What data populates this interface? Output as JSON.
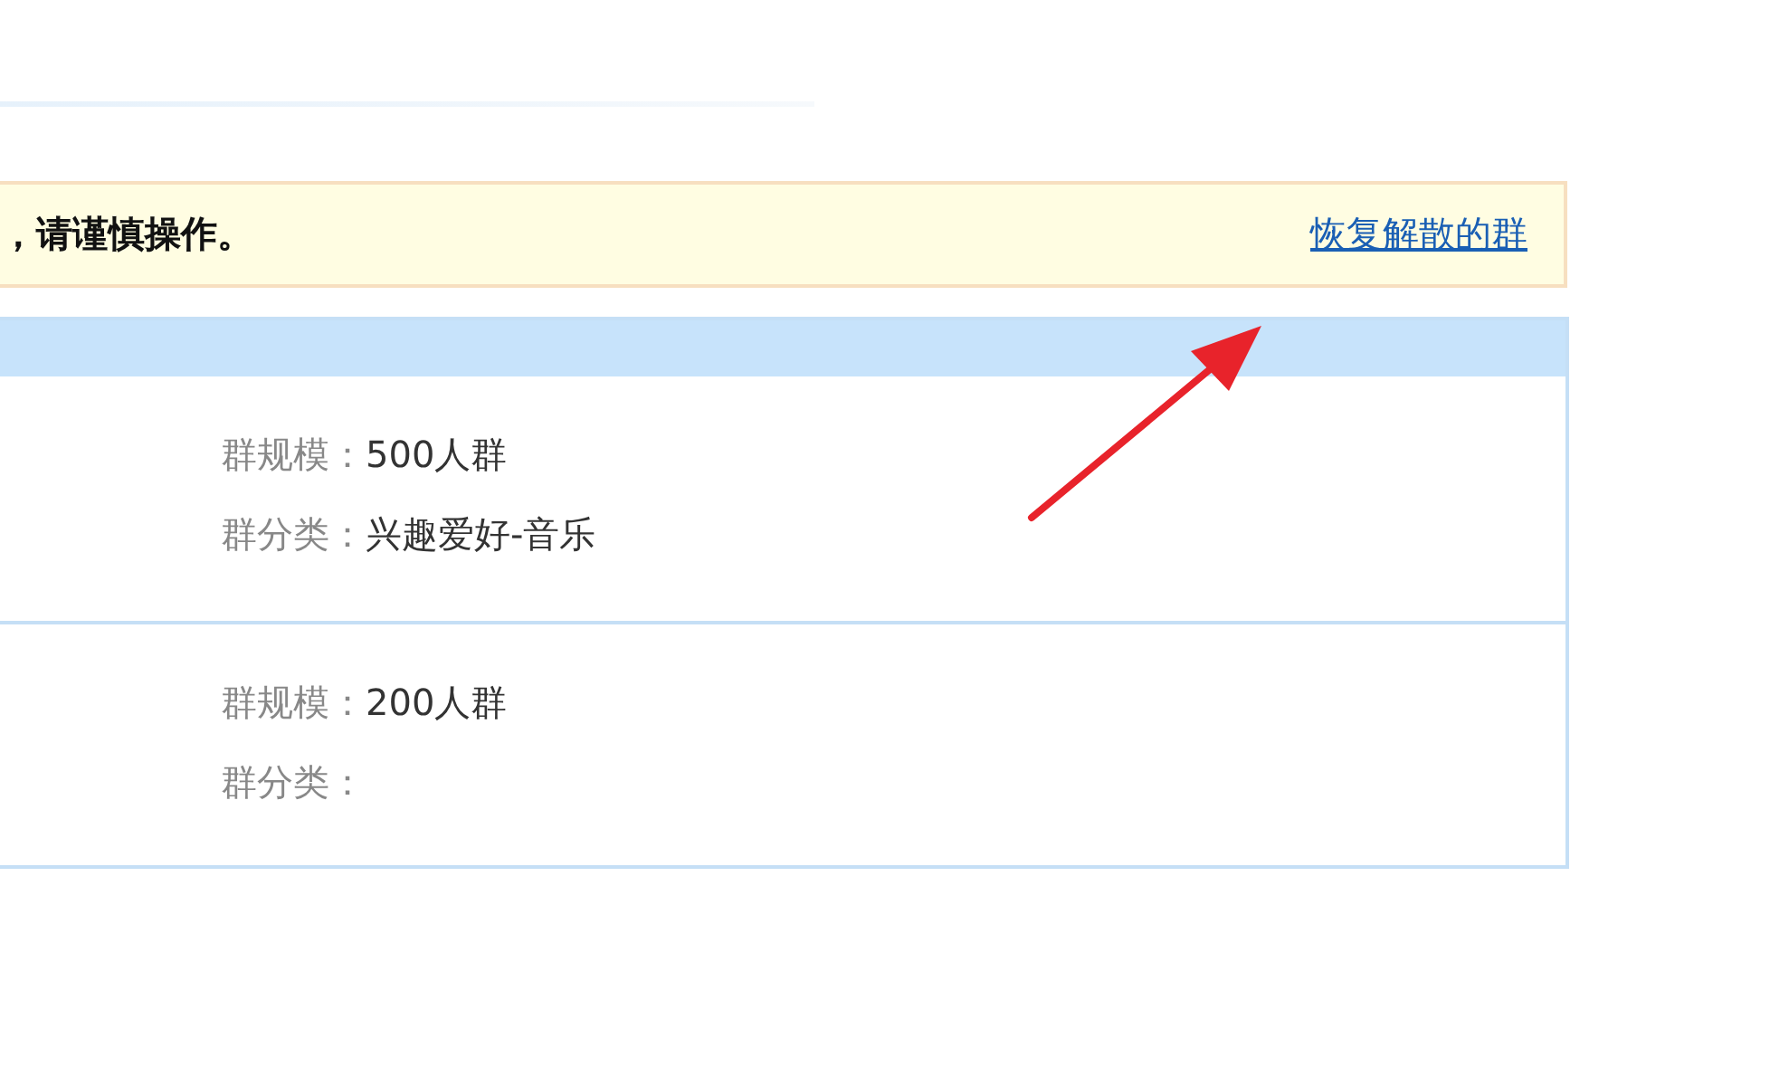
{
  "notice": {
    "text": "，请谨慎操作。",
    "link": "恢复解散的群"
  },
  "groups": [
    {
      "size_label": "群规模：",
      "size": "500人群",
      "category_label": "群分类：",
      "category": "兴趣爱好-音乐"
    },
    {
      "size_label": "群规模：",
      "size": "200人群",
      "category_label": "群分类："
    }
  ]
}
